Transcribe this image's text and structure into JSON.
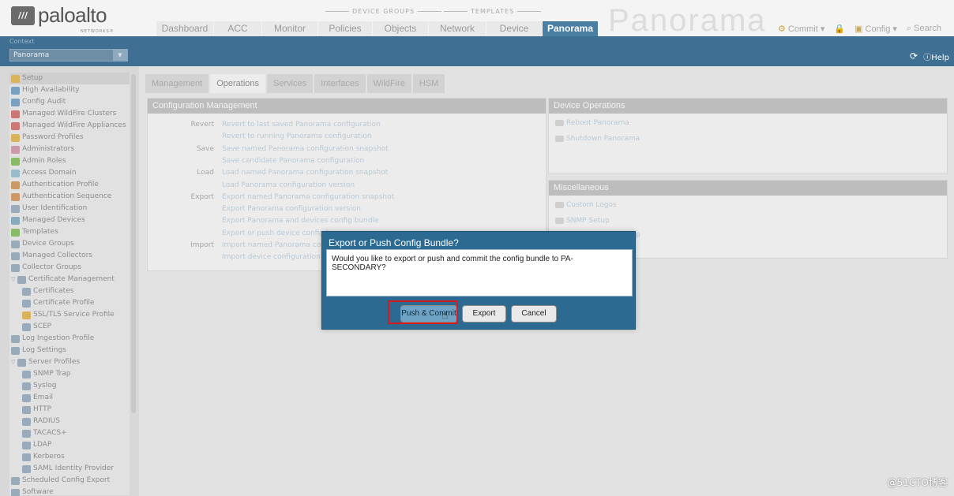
{
  "header": {
    "logo_text": "paloalto",
    "logo_sub": "NETWORKS®",
    "group_device": "DEVICE GROUPS",
    "group_templates": "TEMPLATES",
    "tabs": [
      {
        "label": "Dashboard"
      },
      {
        "label": "ACC"
      },
      {
        "label": "Monitor"
      },
      {
        "label": "Policies"
      },
      {
        "label": "Objects"
      },
      {
        "label": "Network"
      },
      {
        "label": "Device"
      },
      {
        "label": "Panorama",
        "active": true
      }
    ],
    "watermark": "Panorama",
    "commit": "Commit ▾",
    "config": "Config ▾",
    "search": "Search"
  },
  "context": {
    "label": "Context",
    "value": "Panorama",
    "help": "Help"
  },
  "sidebar": {
    "items": [
      {
        "label": "Setup",
        "color": "#d9b35a",
        "sel": true
      },
      {
        "label": "High Availability",
        "color": "#7aa0c0"
      },
      {
        "label": "Config Audit",
        "color": "#7aa0c0"
      },
      {
        "label": "Managed WildFire Clusters",
        "color": "#c77"
      },
      {
        "label": "Managed WildFire Appliances",
        "color": "#c77"
      },
      {
        "label": "Password Profiles",
        "color": "#d9b35a"
      },
      {
        "label": "Administrators",
        "color": "#c9a"
      },
      {
        "label": "Admin Roles",
        "color": "#8b6"
      },
      {
        "label": "Access Domain",
        "color": "#9bc"
      },
      {
        "label": "Authentication Profile",
        "color": "#c96"
      },
      {
        "label": "Authentication Sequence",
        "color": "#c96"
      },
      {
        "label": "User Identification",
        "color": "#9ab"
      },
      {
        "label": "Managed Devices",
        "color": "#8ab"
      },
      {
        "label": "Templates",
        "color": "#8b6"
      },
      {
        "label": "Device Groups",
        "color": "#9ab"
      },
      {
        "label": "Managed Collectors",
        "color": "#9ab"
      },
      {
        "label": "Collector Groups",
        "color": "#9ab"
      },
      {
        "label": "Certificate Management",
        "color": "#9ab",
        "exp": true
      },
      {
        "label": "Certificates",
        "color": "#9ab",
        "sub": true
      },
      {
        "label": "Certificate Profile",
        "color": "#9ab",
        "sub": true
      },
      {
        "label": "SSL/TLS Service Profile",
        "color": "#d9b35a",
        "sub": true
      },
      {
        "label": "SCEP",
        "color": "#9ab",
        "sub": true
      },
      {
        "label": "Log Ingestion Profile",
        "color": "#9ab"
      },
      {
        "label": "Log Settings",
        "color": "#9ab"
      },
      {
        "label": "Server Profiles",
        "color": "#9ab",
        "exp": true
      },
      {
        "label": "SNMP Trap",
        "color": "#9ab",
        "sub": true
      },
      {
        "label": "Syslog",
        "color": "#9ab",
        "sub": true
      },
      {
        "label": "Email",
        "color": "#9ab",
        "sub": true
      },
      {
        "label": "HTTP",
        "color": "#9ab",
        "sub": true
      },
      {
        "label": "RADIUS",
        "color": "#9ab",
        "sub": true
      },
      {
        "label": "TACACS+",
        "color": "#9ab",
        "sub": true
      },
      {
        "label": "LDAP",
        "color": "#9ab",
        "sub": true
      },
      {
        "label": "Kerberos",
        "color": "#9ab",
        "sub": true
      },
      {
        "label": "SAML Identity Provider",
        "color": "#9ab",
        "sub": true
      },
      {
        "label": "Scheduled Config Export",
        "color": "#9ab"
      },
      {
        "label": "Software",
        "color": "#9ab"
      }
    ]
  },
  "subtabs": [
    {
      "label": "Management"
    },
    {
      "label": "Operations",
      "active": true
    },
    {
      "label": "Services"
    },
    {
      "label": "Interfaces"
    },
    {
      "label": "WildFire"
    },
    {
      "label": "HSM"
    }
  ],
  "config_mgmt": {
    "title": "Configuration Management",
    "rows": [
      {
        "label": "Revert",
        "link": "Revert to last saved Panorama configuration"
      },
      {
        "label": "",
        "link": "Revert to running Panorama configuration"
      },
      {
        "label": "Save",
        "link": "Save named Panorama configuration snapshot"
      },
      {
        "label": "",
        "link": "Save candidate Panorama configuration"
      },
      {
        "label": "Load",
        "link": "Load named Panorama configuration snapshot"
      },
      {
        "label": "",
        "link": "Load Panorama configuration version"
      },
      {
        "label": "Export",
        "link": "Export named Panorama configuration snapshot"
      },
      {
        "label": "",
        "link": "Export Panorama configuration version"
      },
      {
        "label": "",
        "link": "Export Panorama and devices config bundle"
      },
      {
        "label": "",
        "link": "Export or push device config bu"
      },
      {
        "label": "Import",
        "link": "Import named Panorama config"
      },
      {
        "label": "",
        "link": "Import device configuration to"
      }
    ]
  },
  "device_ops": {
    "title": "Device Operations",
    "items": [
      "Reboot Panorama",
      "Shutdown Panorama"
    ]
  },
  "misc": {
    "title": "Miscellaneous",
    "items": [
      "Custom Logos",
      "SNMP Setup"
    ],
    "partial": "p"
  },
  "dialog": {
    "title": "Export or Push Config Bundle?",
    "message": "Would you like to export or push and commit the config bundle to PA-SECONDARY?",
    "push_label": "Push & Commit",
    "export_label": "Export",
    "cancel_label": "Cancel"
  },
  "corner_mark": "@51CTO博客"
}
